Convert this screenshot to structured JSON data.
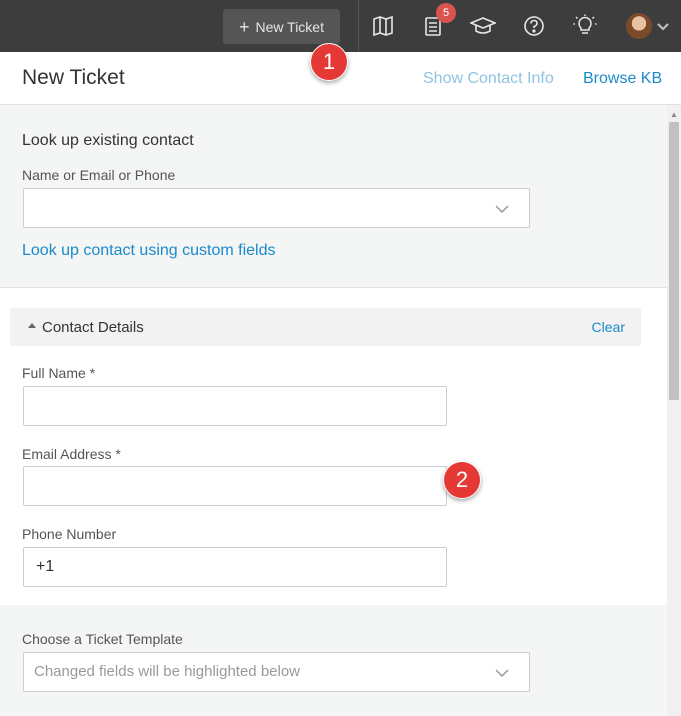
{
  "topbar": {
    "new_ticket_label": "New Ticket",
    "notification_count": "5",
    "icons": [
      "map-icon",
      "ticket-list-icon",
      "graduation-cap-icon",
      "help-icon",
      "lightbulb-icon",
      "avatar",
      "chevron-down-icon"
    ]
  },
  "header": {
    "title": "New Ticket",
    "show_contact_info": "Show Contact Info",
    "browse_kb": "Browse KB"
  },
  "lookup": {
    "heading": "Look up existing contact",
    "field_label": "Name or Email or Phone",
    "field_value": "",
    "custom_fields_link": "Look up contact using custom fields"
  },
  "contact_details": {
    "section_title": "Contact Details",
    "clear_label": "Clear",
    "full_name_label": "Full Name *",
    "full_name_value": "",
    "email_label": "Email Address *",
    "email_value": "",
    "phone_label": "Phone Number",
    "phone_value": "+1"
  },
  "template": {
    "label": "Choose a Ticket Template",
    "placeholder": "Changed fields will be highlighted below"
  },
  "markers": [
    "1",
    "2"
  ],
  "colors": {
    "topbar_bg": "#3d3d3d",
    "link": "#1a8acb",
    "badge": "#d9534f",
    "marker": "#e53935"
  }
}
